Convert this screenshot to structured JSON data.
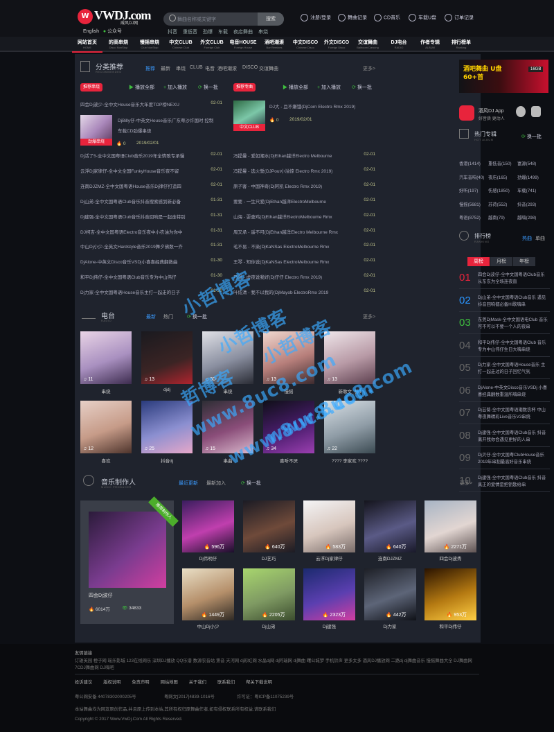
{
  "header": {
    "logo_main": "VWDJ.com",
    "logo_sub": "威风DJ网",
    "search_placeholder": "舞曲名称或关键字",
    "search_button": "搜索",
    "login": "注册/登录",
    "upload": "舞曲记录",
    "cd": "CD音乐",
    "car": "车载U盘",
    "order": "订单记录",
    "lang": "English",
    "wechat": "公众号",
    "hot_terms": [
      "抖音",
      "重低音",
      "劲爆",
      "车载",
      "夜店舞曲",
      "串烧"
    ]
  },
  "nav": [
    {
      "cn": "网站首页",
      "en": "HOME"
    },
    {
      "cn": "的高串烧",
      "en": "Disco NonStop"
    },
    {
      "cn": "慢摇串烧",
      "en": "Club NonStop"
    },
    {
      "cn": "中文CLUB",
      "en": "Chinese Club"
    },
    {
      "cn": "外文CLUB",
      "en": "Foreign Club"
    },
    {
      "cn": "电音HOUSE",
      "en": "Foreign House"
    },
    {
      "cn": "酒吧潮滚",
      "en": "Bar Remixes"
    },
    {
      "cn": "中文DISCO",
      "en": "Chinese Disco"
    },
    {
      "cn": "外文DISCO",
      "en": "Foreign Disco"
    },
    {
      "cn": "交谊舞曲",
      "en": "Ballroom Dancing"
    },
    {
      "cn": "DJ电台",
      "en": "RADIO"
    },
    {
      "cn": "作者专辑",
      "en": "ALBUM"
    },
    {
      "cn": "排行榜单",
      "en": "Ranking"
    }
  ],
  "recommend": {
    "title": "分类推荐",
    "en": "RECOMMENDED",
    "tabs": [
      "推荐",
      "最新",
      "串烧",
      "CLUB",
      "电音",
      "酒吧潮滚",
      "DISCO",
      "交谊舞曲"
    ],
    "more": "更多>",
    "left_badge": "推荐串烧",
    "right_badge": "推荐专曲",
    "play_all": "播放全部",
    "add_list": "加入播放",
    "change": "换一批",
    "left_top": "四会Dj波少-全中文House音乐大年度TOP榜NEXU",
    "left_top_date": "02-01",
    "left_feat_title": "DjBilly仔-中英文House音乐广东粤沙许国时 控制车载CD劲爆串烧",
    "left_feat_tag": "劲爆串烧",
    "left_feat_count": "0",
    "left_feat_date": "2019/02/01",
    "right_feat_title": "DJ大 - 且不嫌饿(DjCorn Electro Rmx 2019)",
    "right_feat_tag": "中文CLUB",
    "right_feat_count": "0",
    "right_feat_date": "2019/02/01",
    "left_rows": [
      [
        "Dj活了5-全中文国粤语Club音乐2019年全情歌专承慢",
        "02-01"
      ],
      [
        "云浮Dj家律仔-全中文全国FunkyHouse音乐夜不留",
        "02-01"
      ],
      [
        "连南DJZMZ-全中文国粤语House音乐Dj律仔打造四",
        "02-01"
      ],
      [
        "Dj山弟-全中文国粤语Club音乐抖音搜索感到新必备",
        "01-31"
      ],
      [
        "Dj建强-全中文国粤语Club音乐抖音回响是一起走特别",
        "01-31"
      ],
      [
        "DJ柯吉-全中文国粤语Electro音乐夜中小农油为你中",
        "01-31"
      ],
      [
        "中山Dj小少-全英文Hardstyle音乐2019舞夕佛数一齐",
        "01-31"
      ],
      [
        "DjAlone-中英文Disco音乐VSDj小喜喜经典翻数曲",
        "01-30"
      ],
      [
        "和平Dj伟仔-全中文国粤语Club音乐专为中山伟仔",
        "01-30"
      ],
      [
        "Dj力家-全中文国粤语House音乐主打一起走的日子",
        "01-30"
      ]
    ],
    "right_rows": [
      [
        "冯提曼 - 爱如潮水(DjEthan越洋Electro Melbourne",
        "02-01"
      ],
      [
        "冯提曼 - 选火誓(DJPout小溢惊 Electro Rmx 2019)",
        "02-01"
      ],
      [
        "原子客 - 中国神奇(Dj阿凯 Electro Rmx 2019)",
        "02-01"
      ],
      [
        "要要 - 一生只爱(DjEthan越洋ElectroMelbourne",
        "02-01"
      ],
      [
        "山海 - 耍查鸡(DjEthan越洋ElectroMelbourne Rmx",
        "02-01"
      ],
      [
        "周又承 - 遥不可(DjEthan越洋Electro Melbourne Rmx",
        "02-01"
      ],
      [
        "毛不易 - 不染(DjKaNSas ElectroMelbourne Rmx",
        "02-01"
      ],
      [
        "王琴 - 知你说(DjKaNSas ElectroMelbourne Rmx",
        "02-01"
      ],
      [
        "乃哥 - 虚夜说我好(Dj仔仔 Electro Rmx 2019)",
        "02-01"
      ],
      [
        "叶炫清 - 我不以我的(DjMayob ElectroRmx 2019",
        "02-01"
      ]
    ]
  },
  "radio": {
    "title": "电台",
    "en": "RADIO",
    "tabs": [
      "最新",
      "热门"
    ],
    "change": "换一批",
    "more": "更多>",
    "items": [
      {
        "count": "11",
        "name": "串烧"
      },
      {
        "count": "13",
        "name": "djdj"
      },
      {
        "count": "30",
        "name": "串烧"
      },
      {
        "count": "13",
        "name": "慢摇"
      },
      {
        "count": "13",
        "name": "新歌文_标.l"
      },
      {
        "count": "12",
        "name": "喜欢"
      },
      {
        "count": "25",
        "name": "抖音dj"
      },
      {
        "count": "15",
        "name": "串曲"
      },
      {
        "count": "34",
        "name": "喜听不厌"
      },
      {
        "count": "22",
        "name": "???? 李家欢 ????"
      }
    ]
  },
  "producer": {
    "title": "音乐制作人",
    "en": "MUSIC PRODUCER",
    "tabs": [
      "最近更新",
      "最新加入"
    ],
    "change": "换一批",
    "more": "更多>",
    "feat_name": "四会Dj波仔",
    "feat_ribbon": "推荐制作人",
    "feat_fans": "6014万",
    "feat_views": "34833",
    "items": [
      {
        "count": "596万",
        "name": "Dj伟明仔"
      },
      {
        "count": "640万",
        "name": "DJ艺巧"
      },
      {
        "count": "583万",
        "name": "云浮Dj家律仔"
      },
      {
        "count": "640万",
        "name": "连南DJZMZ"
      },
      {
        "count": "2271万",
        "name": "四会Dj波秀"
      },
      {
        "count": "1449万",
        "name": "中山Dj小少"
      },
      {
        "count": "2205万",
        "name": "Dj山弟"
      },
      {
        "count": "2323万",
        "name": "Dj建强"
      },
      {
        "count": "442万",
        "name": "Dj力家"
      },
      {
        "count": "953万",
        "name": "和平Dj伟仔"
      }
    ]
  },
  "side": {
    "banner_text": "酒吧舞曲 U盘 60+首",
    "banner_tag": "16GB",
    "app_title": "酒风DJ App",
    "app_sub": "好音质 更动人",
    "hot_album": "热门专辑",
    "hot_en": "HOT ALBUM",
    "change": "换一批",
    "album_rows": [
      [
        "香港(1414)",
        "重低音(150)",
        "富源(548)"
      ],
      [
        "汽车音响(40)",
        "夜店(165)",
        "劲爆(1499)"
      ],
      [
        "好听(197)",
        "伤感(1850)",
        "车载(741)"
      ],
      [
        "慢摇(5681)",
        "苏荷(552)",
        "抖音(293)"
      ],
      [
        "粤语(8752)",
        "越南(79)",
        "越嗨(298)"
      ]
    ],
    "rank_title": "排行榜",
    "rank_en": "RANKING",
    "rank_links": [
      "热曲",
      "单曲"
    ],
    "rank_tabs": [
      "周榜",
      "月榜",
      "年榜"
    ],
    "ranks": [
      "四会Dj波仔-全中文国粤语Club音乐从东东为全场连夜直",
      "Dj山弟-全中文国粤语Club音乐 遇见抖音回响都必备Hi歌嗨串",
      "东莞DjMask-全中文国语电Club 音乐可不可以不要一个人的夜串",
      "和平Dj伟仔-全中文国粤语Club 音乐专为中山伟仔生日大嗨串烧",
      "Dj力家-全中文国粤语House音乐 主打一起走过的日子回忆气氛",
      "DjAlone-中英文Disco音乐VSDj 小喜喜经典翻数重温所嗨串烧",
      "Dj芸菊-全中文国粤语潮数农杯 中山粤夜舞精彩Live音乐V3串烧",
      "Dj建强-全中文国粤语Club音乐 抖音离开我你会遇见更好的人串",
      "Dj贝仔-全中文国粤ClubHouse音乐 2019年串割最高好音乐串烧",
      "Dj建强-全中文国粤语Club音乐 抖音真正的爱情是把钥匙给串"
    ]
  },
  "footer": {
    "links_title": "友情链接",
    "links": "订雄英园 橙子网 瑶乐影城 123在线网乐 深圳DJ播放 QQ乐谱 数源农音站 第音 天河网 dj彩虹网 水晶dj网 dj阿瑞网 dj舞曲 曙公城梦 手机铃声 更多太多 酒风DJ播放网 二路dj dj舞曲音乐 慢摇舞曲大全 DJ舞曲网 7CDJ舞曲网 DJ嗨吧",
    "nav": [
      "投诉建议",
      "版权说明",
      "免责声明",
      "网站地图",
      "关于我们",
      "联系我们",
      "帮关下载说明"
    ],
    "license1": "粤公网安备 44078302000205号",
    "license2": "粤网文[2017]4839-1016号",
    "license3": "许可证：粤ICP备11075239号",
    "notice": "本站舞曲均为网友原创作品,并且原上传到本站,其所有权归原舞曲作者,如有侵权联系所有权益,请联系我们",
    "copyright": "Copyright © 2017 Www.VwDj.Com All Rights Reserved."
  },
  "watermark": [
    "小哲博客",
    "小哲博客",
    "小哲博客",
    "哲博客",
    "www.8uc8.com",
    "www.8uc8.com",
    "www.8uc8.com"
  ],
  "colors": {
    "accent": "#e8243c",
    "green": "#3fbf3f",
    "panel": "#1f232d",
    "bg": "#0d0f14"
  }
}
